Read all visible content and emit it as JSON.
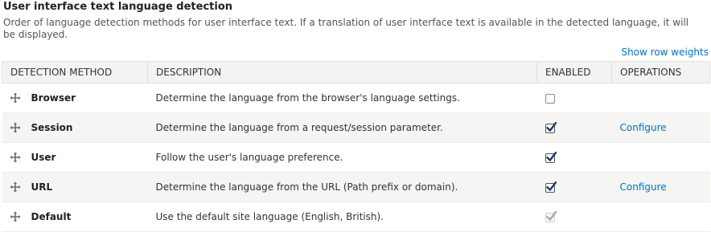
{
  "section": {
    "title": "User interface text language detection",
    "description": "Order of language detection methods for user interface text. If a translation of user interface text is available in the detected language, it will be displayed.",
    "show_row_weights": "Show row weights"
  },
  "table": {
    "headers": {
      "method": "DETECTION METHOD",
      "description": "DESCRIPTION",
      "enabled": "ENABLED",
      "operations": "OPERATIONS"
    },
    "rows": [
      {
        "method": "Browser",
        "description": "Determine the language from the browser's language settings.",
        "enabled": false,
        "disabled": false,
        "operation": ""
      },
      {
        "method": "Session",
        "description": "Determine the language from a request/session parameter.",
        "enabled": true,
        "disabled": false,
        "operation": "Configure"
      },
      {
        "method": "User",
        "description": "Follow the user's language preference.",
        "enabled": true,
        "disabled": false,
        "operation": ""
      },
      {
        "method": "URL",
        "description": "Determine the language from the URL (Path prefix or domain).",
        "enabled": true,
        "disabled": false,
        "operation": "Configure"
      },
      {
        "method": "Default",
        "description": "Use the default site language (English, British).",
        "enabled": true,
        "disabled": true,
        "operation": ""
      }
    ]
  },
  "icons": {
    "drag": "drag-handle-icon",
    "check": "checkmark-icon"
  },
  "colors": {
    "link": "#0074bd",
    "header_bg": "#f3f3f1",
    "row_alt_bg": "#f5f5f3",
    "check_active": "#1a3a6e",
    "check_disabled": "#a8a8a8"
  }
}
